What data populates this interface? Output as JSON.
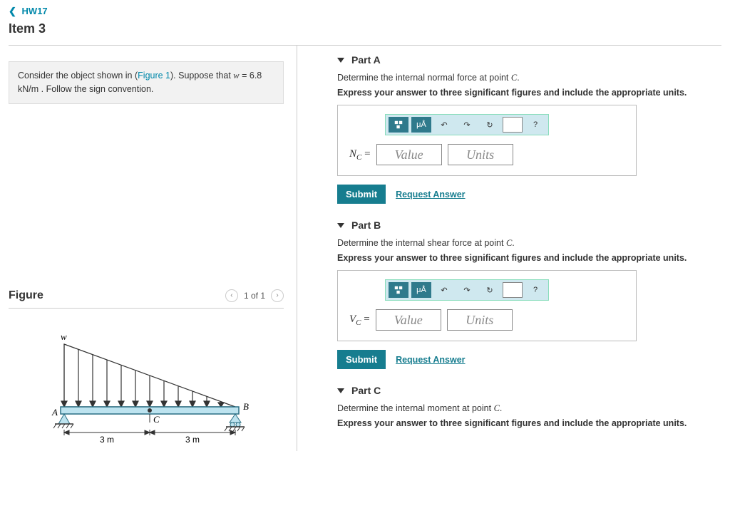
{
  "nav": {
    "back": "HW17"
  },
  "item_title": "Item 3",
  "problem": {
    "pre": "Consider the object shown in (",
    "figlink": "Figure 1",
    "post": "). Suppose that ",
    "eq_lhs": "w",
    "eq_val": " = 6.8  kN/m",
    "tail": " . Follow the sign convention."
  },
  "figure": {
    "title": "Figure",
    "counter": "1 of 1",
    "labels": {
      "w": "w",
      "A": "A",
      "B": "B",
      "C": "C",
      "span1": "3 m",
      "span2": "3 m"
    }
  },
  "parts": {
    "A": {
      "title": "Part A",
      "prompt_pre": "Determine the internal normal force at point ",
      "prompt_pt": "C",
      "prompt_post": ".",
      "instr": "Express your answer to three significant figures and include the appropriate units.",
      "var_base": "N",
      "var_sub": "C",
      "equals": " =",
      "value_ph": "Value",
      "units_ph": "Units",
      "submit": "Submit",
      "request": "Request Answer",
      "tb": {
        "uA": "μÅ",
        "help": "?"
      }
    },
    "B": {
      "title": "Part B",
      "prompt_pre": "Determine the internal shear force at point ",
      "prompt_pt": "C",
      "prompt_post": ".",
      "instr": "Express your answer to three significant figures and include the appropriate units.",
      "var_base": "V",
      "var_sub": "C",
      "equals": " =",
      "value_ph": "Value",
      "units_ph": "Units",
      "submit": "Submit",
      "request": "Request Answer",
      "tb": {
        "uA": "μÅ",
        "help": "?"
      }
    },
    "C": {
      "title": "Part C",
      "prompt_pre": "Determine the internal moment at point ",
      "prompt_pt": "C",
      "prompt_post": ".",
      "instr": "Express your answer to three significant figures and include the appropriate units."
    }
  }
}
